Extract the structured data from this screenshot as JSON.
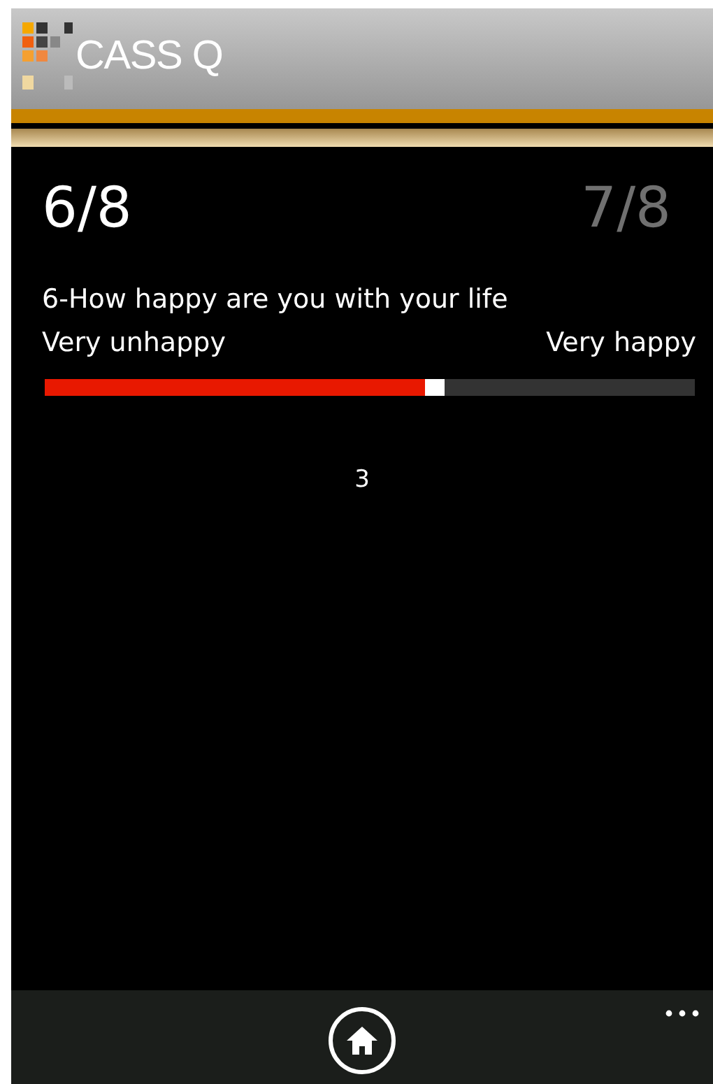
{
  "app": {
    "title": "CASS Q"
  },
  "question": {
    "current": "6/8",
    "next": "7/8",
    "text": "6-How happy are you with your life",
    "min_label": "Very unhappy",
    "max_label": "Very happy",
    "level": 0.6,
    "value": "3"
  }
}
